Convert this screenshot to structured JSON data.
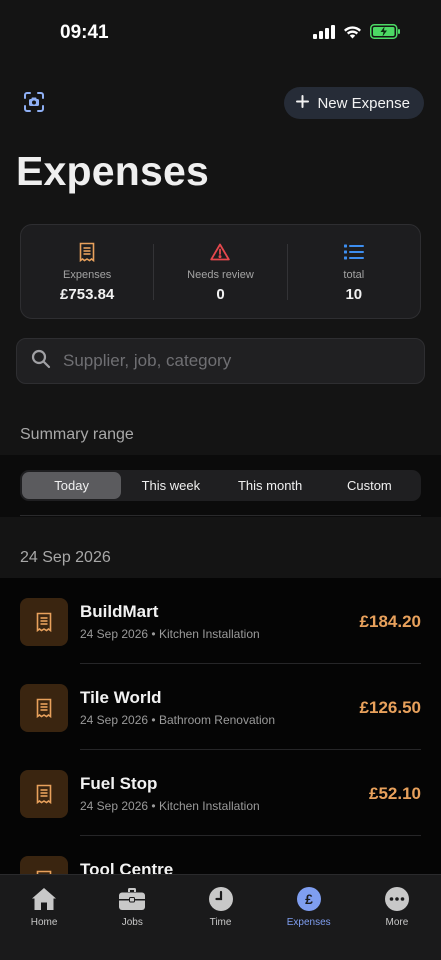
{
  "status_bar": {
    "time": "09:41"
  },
  "header": {
    "new_expense_label": "New Expense",
    "title": "Expenses"
  },
  "stats": {
    "expenses": {
      "label": "Expenses",
      "value": "£753.84"
    },
    "needs_review": {
      "label": "Needs review",
      "value": "0"
    },
    "total": {
      "label": "total",
      "value": "10"
    }
  },
  "search": {
    "placeholder": "Supplier, job, category",
    "value": ""
  },
  "summary_range": {
    "label": "Summary range",
    "options": [
      "Today",
      "This week",
      "This month",
      "Custom"
    ],
    "selected": "Today"
  },
  "list": {
    "date_header": "24 Sep 2026",
    "items": [
      {
        "name": "BuildMart",
        "date": "24 Sep 2026",
        "job": "Kitchen Installation",
        "amount": "£184.20"
      },
      {
        "name": "Tile World",
        "date": "24 Sep 2026",
        "job": "Bathroom Renovation",
        "amount": "£126.50"
      },
      {
        "name": "Fuel Stop",
        "date": "24 Sep 2026",
        "job": "Kitchen Installation",
        "amount": "£52.10"
      },
      {
        "name": "Tool Centre",
        "date": "",
        "job": "",
        "amount": ""
      }
    ]
  },
  "tabs": [
    {
      "label": "Home",
      "icon": "house-icon"
    },
    {
      "label": "Jobs",
      "icon": "briefcase-icon"
    },
    {
      "label": "Time",
      "icon": "clock-icon"
    },
    {
      "label": "Expenses",
      "icon": "pound-icon",
      "active": true
    },
    {
      "label": "More",
      "icon": "ellipsis-icon"
    }
  ],
  "colors": {
    "accent_amount": "#e8a15c",
    "accent_blue": "#7f9ef0",
    "warning_red": "#e5484d",
    "icon_orange": "#e8a15c"
  }
}
